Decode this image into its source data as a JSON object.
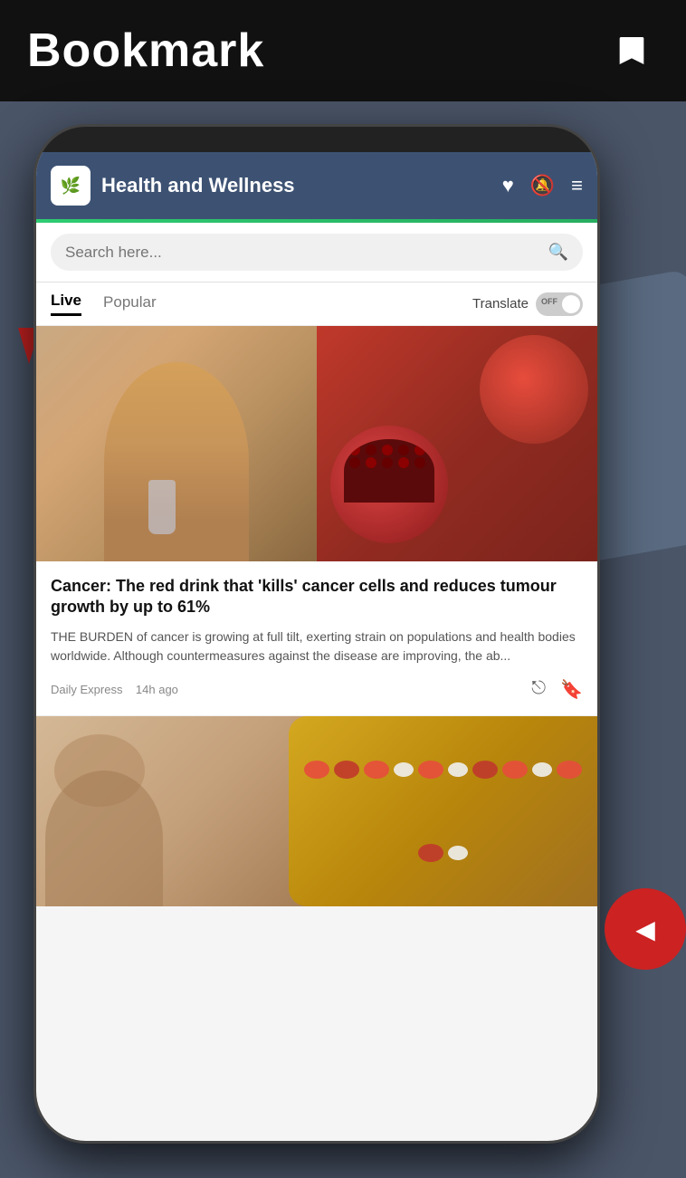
{
  "top_bar": {
    "title": "Bookmark",
    "bookmark_icon_label": "bookmark"
  },
  "app": {
    "title": "Health and Wellness",
    "logo_text": "🌿",
    "header": {
      "heart_icon": "heart",
      "bell_icon": "bell-mute",
      "menu_icon": "hamburger-menu"
    },
    "search": {
      "placeholder": "Search here..."
    },
    "tabs": [
      {
        "label": "Live",
        "active": true
      },
      {
        "label": "Popular",
        "active": false
      }
    ],
    "translate": {
      "label": "Translate",
      "toggle_state": "OFF"
    },
    "articles": [
      {
        "title": "Cancer: The red drink that 'kills' cancer cells and reduces tumour growth by up to 61%",
        "excerpt": "THE BURDEN of cancer is growing at full tilt, exerting strain on populations and health bodies worldwide. Although countermeasures against the disease are improving, the ab...",
        "source": "Daily Express",
        "time_ago": "14h ago",
        "share_icon": "share",
        "bookmark_icon": "bookmark"
      }
    ]
  }
}
